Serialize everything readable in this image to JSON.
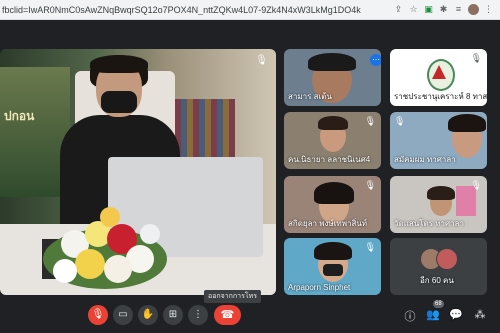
{
  "browser": {
    "url": "fbclid=IwAR0NmC0sAwZNqBwqrSQ12o7POX4N_nttZQKw4L07-9Zk4N4xW3LkMg1DO4k"
  },
  "participants": [
    {
      "label": "สามาร สเต้น"
    },
    {
      "label": "ราชประชานุเคราะห์ 8 ทาสาลา"
    },
    {
      "label": "คน.นิธายา ลลาชนิเนศ4"
    },
    {
      "label": "สมัคมผม ทาศาลา"
    },
    {
      "label": "สกิดยุลา พงษ์เทพาสิ่นท์"
    },
    {
      "label": "วัดแสนโตร ทาศาลา"
    },
    {
      "label": "Arpaporn Sinphet"
    },
    {
      "label": "อีก 60 คน"
    }
  ],
  "speaker": {
    "poster_text": "ปกอน"
  },
  "controls": {
    "tooltip": "ออกจากการโทร",
    "people_count": "68"
  }
}
